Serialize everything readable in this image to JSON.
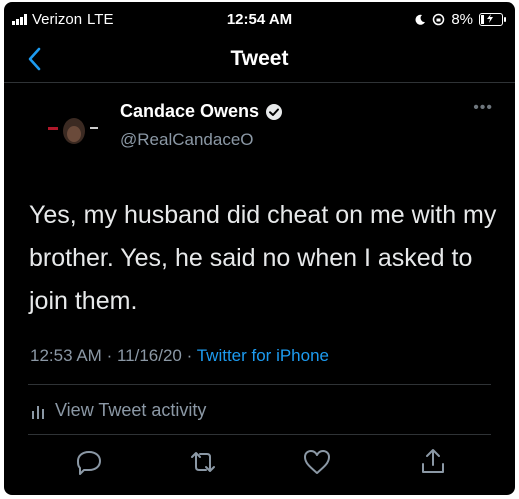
{
  "status_bar": {
    "carrier": "Verizon",
    "network": "LTE",
    "time": "12:54 AM",
    "battery_percent": "8%"
  },
  "nav": {
    "title": "Tweet",
    "back_icon": "chevron-left-icon"
  },
  "tweet": {
    "author_name": "Candace Owens",
    "author_handle": "@RealCandaceO",
    "verified": true,
    "text": "Yes, my husband did cheat on me with my brother. Yes, he said no when I asked to join them.",
    "time": "12:53 AM",
    "date": "11/16/20",
    "separator": "·",
    "source": "Twitter for iPhone",
    "activity_label": "View Tweet activity"
  },
  "colors": {
    "background": "#000000",
    "accent": "#1d9bf0",
    "secondary_text": "#8b98a5",
    "divider": "#2f3336"
  },
  "icons": [
    "signal-icon",
    "moon-icon",
    "lock-rotation-icon",
    "battery-charging-icon",
    "verified-badge-icon",
    "more-icon",
    "activity-bars-icon",
    "reply-icon",
    "retweet-icon",
    "like-icon",
    "share-icon"
  ]
}
